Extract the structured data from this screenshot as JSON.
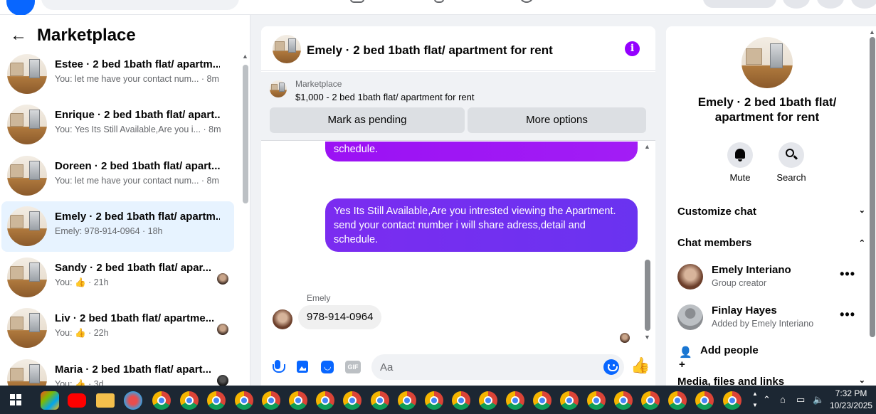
{
  "sidebar": {
    "title": "Marketplace",
    "conversations": [
      {
        "title": "Estee · 2 bed 1bath flat/ apartm...",
        "preview": "You: let me have your contact num...",
        "time": "· 8m"
      },
      {
        "title": "Enrique · 2 bed 1bath flat/ apart...",
        "preview": "You: Yes Its Still Available,Are you i...",
        "time": "· 8m"
      },
      {
        "title": "Doreen · 2 bed 1bath flat/ apart...",
        "preview": "You: let me have your contact num...",
        "time": "· 8m"
      },
      {
        "title": "Emely · 2 bed 1bath flat/ apartm...",
        "preview": "Emely: 978-914-0964",
        "time": "· 18h"
      },
      {
        "title": "Sandy · 2 bed 1bath flat/ apar...",
        "preview": "You: 👍",
        "time": "· 21h"
      },
      {
        "title": "Liv · 2 bed 1bath flat/ apartme...",
        "preview": "You: 👍",
        "time": "· 22h"
      },
      {
        "title": "Maria · 2 bed 1bath flat/ apart...",
        "preview": "You: 👍",
        "time": "· 3d"
      }
    ]
  },
  "chat": {
    "header_name": "Emely · 2 bed 1bath flat/ apartment for rent",
    "marketplace_label": "Marketplace",
    "listing_title": "$1,000 - 2 bed 1bath flat/ apartment for rent",
    "mark_pending_label": "Mark as pending",
    "more_options_label": "More options",
    "messages": {
      "partial_out": "schedule.",
      "out": "Yes Its Still Available,Are you intrested viewing the Apartment. send your contact number i will share adress,detail and schedule.",
      "in_sender": "Emely",
      "in": "978-914-0964"
    },
    "composer_placeholder": "Aa",
    "gif_label": "GIF"
  },
  "details": {
    "name": "Emely · 2 bed 1bath flat/ apartment for rent",
    "mute_label": "Mute",
    "search_label": "Search",
    "customize_chat": "Customize chat",
    "chat_members": "Chat members",
    "members": [
      {
        "name": "Emely Interiano",
        "role": "Group creator"
      },
      {
        "name": "Finlay Hayes",
        "role": "Added by Emely Interiano"
      }
    ],
    "add_people": "Add people",
    "media_files_links": "Media, files and links"
  },
  "taskbar": {
    "time": "7:32 PM",
    "date": "10/23/2025"
  },
  "colors": {
    "accent": "#0866ff",
    "outgoing_bubble": "#7b2cf0",
    "info_button": "#9400ff",
    "active_conversation": "#e7f3ff"
  }
}
